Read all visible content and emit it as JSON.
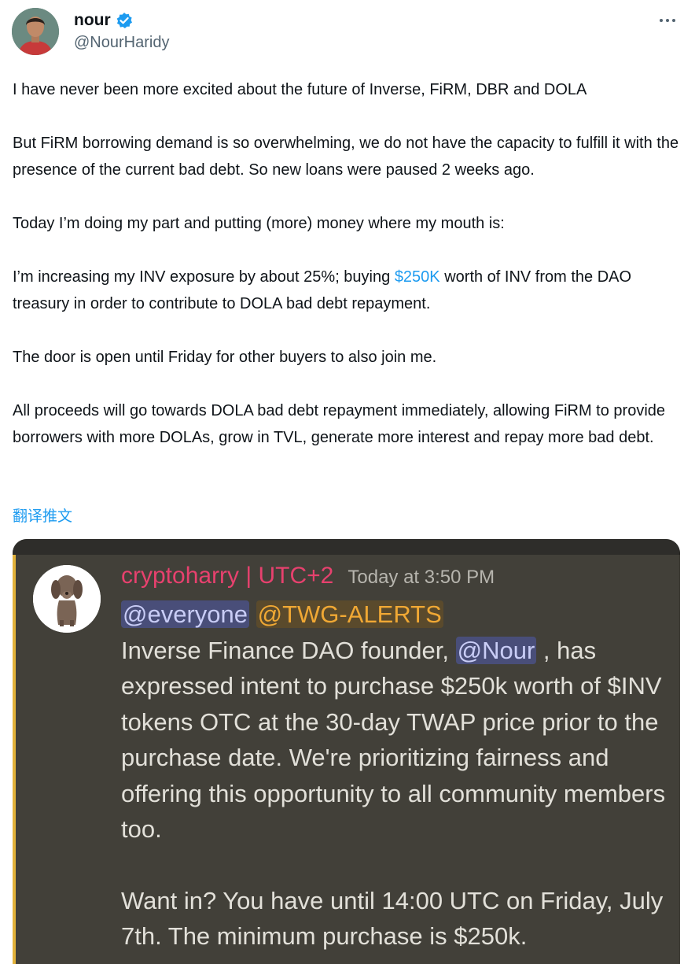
{
  "author": {
    "display_name": "nour",
    "handle": "@NourHaridy",
    "verified_icon": "verified-badge-icon"
  },
  "tweet": {
    "paragraphs": [
      {
        "text": "I have never been more excited about the future of Inverse, FiRM, DBR and DOLA"
      },
      {
        "text": "But FiRM borrowing demand is so overwhelming, we do not have the capacity to fulfill it with the presence of the current bad debt. So new loans were paused 2 weeks ago."
      },
      {
        "text": "Today I’m doing my part and putting (more) money where my mouth is:"
      },
      {
        "before": "I’m increasing my INV exposure by about 25%; buying ",
        "link": "$250K",
        "after": " worth of INV from the DAO treasury in order to contribute to DOLA bad debt repayment."
      },
      {
        "text": "The door is open until Friday for other buyers to also join me."
      },
      {
        "text": "All proceeds will go towards DOLA bad debt repayment immediately, allowing FiRM to provide borrowers with more DOLAs, grow in TVL, generate more interest and repay more bad debt."
      }
    ],
    "translate_label": "翻译推文"
  },
  "embedded_screenshot": {
    "author": "cryptoharry | UTC+2",
    "timestamp": "Today at 3:50 PM",
    "mention_everyone": "@everyone",
    "mention_role": "@TWG-ALERTS",
    "line1_before": "Inverse Finance DAO founder, ",
    "line1_mention": "@Nour",
    "line1_after": " , has expressed intent to purchase $250k worth of $INV tokens OTC at the 30-day TWAP price prior to the purchase date. We're prioritizing fairness and offering this opportunity to all community members too.",
    "line2": "Want in? You have until 14:00 UTC on Friday, July 7th. The minimum purchase is $250k."
  },
  "colors": {
    "link": "#1d9bf0",
    "discord_author": "#e7416e",
    "discord_bg": "#424039",
    "accent_bar": "#e2b23a"
  }
}
